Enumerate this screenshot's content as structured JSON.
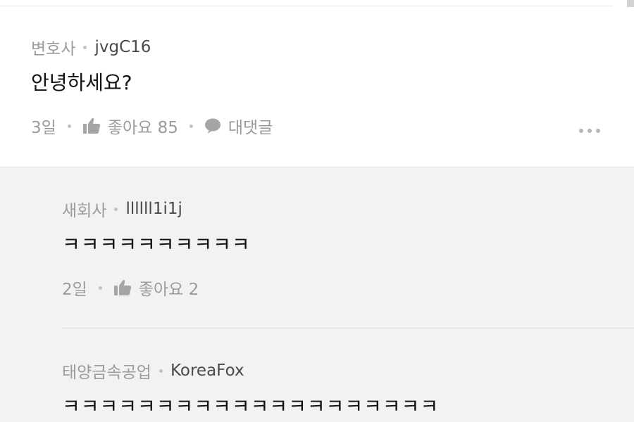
{
  "comment": {
    "company": "변호사",
    "nickname": "jvgC16",
    "text": "안녕하세요?",
    "time": "3일",
    "like_label": "좋아요 85",
    "reply_label": "대댓글"
  },
  "replies": [
    {
      "company": "새회사",
      "nickname": "llllll1i1j",
      "text": "ㅋㅋㅋㅋㅋㅋㅋㅋㅋㅋ",
      "time": "2일",
      "like_label": "좋아요 2"
    },
    {
      "company": "태양금속공업",
      "nickname": "KoreaFox",
      "text": "ㅋㅋㅋㅋㅋㅋㅋㅋㅋㅋㅋㅋㅋㅋㅋㅋㅋㅋㅋㅋ"
    }
  ],
  "icons": {
    "like": "thumbs-up-icon",
    "reply": "speech-bubble-icon",
    "more": "more-dots-icon"
  }
}
